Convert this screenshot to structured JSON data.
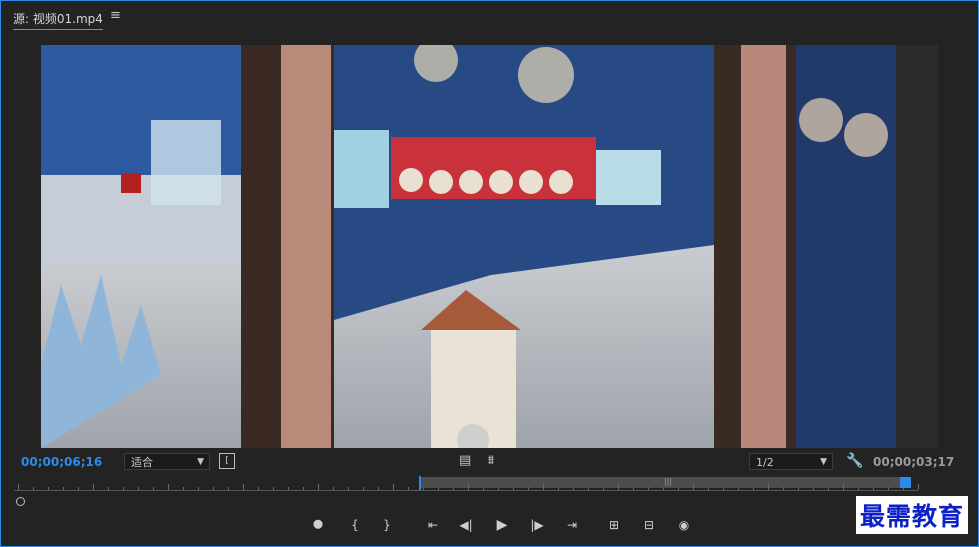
{
  "panel": {
    "title": "源: 视频01.mp4",
    "menu_icon": "hamburger-menu-icon"
  },
  "monitor": {
    "current_timecode": "00;00;06;16",
    "duration_timecode": "00;00;03;17",
    "zoom_label": "适合",
    "resolution_label": "1/2",
    "icons": {
      "safe_margins": "export-frame-icon",
      "drag_video": "film-strip-icon",
      "drag_audio": "audio-waveform-icon",
      "settings": "wrench-icon"
    }
  },
  "timeline": {
    "in_out_range_fraction": [
      0.448,
      0.987
    ],
    "playhead_fraction": 0.986
  },
  "transport": {
    "buttons": [
      {
        "name": "add-marker-button",
        "glyph": "⯃"
      },
      {
        "name": "mark-in-button",
        "glyph": "{"
      },
      {
        "name": "mark-out-button",
        "glyph": "}"
      },
      {
        "name": "go-to-in-button",
        "glyph": "⇤"
      },
      {
        "name": "step-back-button",
        "glyph": "◀"
      },
      {
        "name": "play-button",
        "glyph": "▶"
      },
      {
        "name": "step-forward-button",
        "glyph": "▶"
      },
      {
        "name": "go-to-out-button",
        "glyph": "⇥"
      },
      {
        "name": "insert-button",
        "glyph": "⊞"
      },
      {
        "name": "overwrite-button",
        "glyph": "⊟"
      },
      {
        "name": "export-frame-button",
        "glyph": "◉"
      }
    ]
  },
  "watermark": {
    "text": "最需教育"
  },
  "colors": {
    "accent": "#2d8ceb",
    "panel_bg": "#232323",
    "watermark_text": "#0c22c8"
  }
}
